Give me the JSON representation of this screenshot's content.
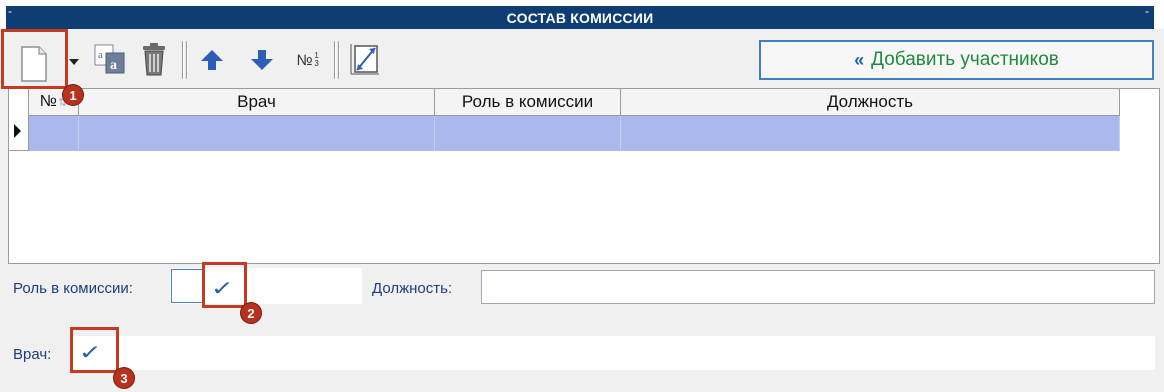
{
  "title": "СОСТАВ КОМИССИИ",
  "title_dash": "-",
  "toolbar": {
    "number_icon_text": "№",
    "number_icon_fraction": "1 3",
    "add_participants_label": "Добавить участников",
    "add_participants_chevron": "«"
  },
  "grid": {
    "columns": [
      "№",
      "Врач",
      "Роль в комиссии",
      "Должность"
    ],
    "rows": [
      [
        "",
        "",
        "",
        ""
      ]
    ],
    "selected_row": 0
  },
  "form": {
    "role_label": "Роль в комиссии:",
    "role_value": "",
    "position_label": "Должность:",
    "position_value": "",
    "doctor_label": "Врач:",
    "doctor_value": ""
  },
  "annotations": [
    "1",
    "2",
    "3"
  ],
  "colors": {
    "title_bg": "#0e3d74",
    "selected_row": "#aab8ee",
    "add_button_border": "#3f7fc6",
    "add_button_text": "#1f8a3f",
    "highlight": "#c23b22",
    "label_text": "#1c3f7a"
  }
}
